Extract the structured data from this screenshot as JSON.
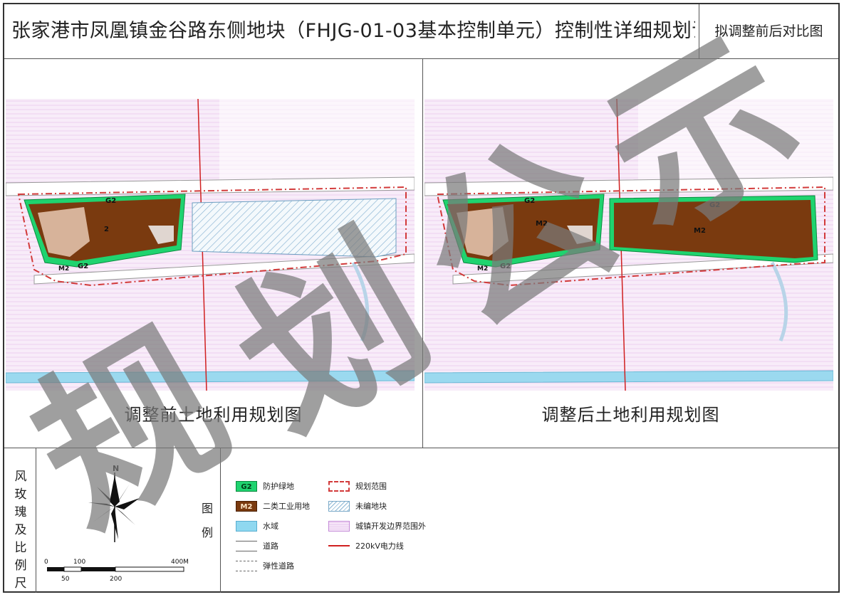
{
  "header": {
    "title": "张家港市凤凰镇金谷路东侧地块（FHJG-01-03基本控制单元）控制性详细规划调整",
    "subtitle": "拟调整前后对比图"
  },
  "panels": {
    "before": {
      "caption": "调整前土地利用规划图",
      "labels": {
        "g2_top": "G2",
        "g2_bottom": "G2",
        "m2_small": "M2",
        "m2_main": "2"
      }
    },
    "after": {
      "caption": "调整后土地利用规划图",
      "labels": {
        "g2_top": "G2",
        "g2_right": "G2",
        "g2_bottom": "G2",
        "m2_left": "M2",
        "m2_right": "M2",
        "m2_small": "M2"
      }
    }
  },
  "scale": {
    "title_chars": [
      "风",
      "玫",
      "瑰",
      "及",
      "比",
      "例",
      "尺"
    ],
    "north": "N",
    "ticks_top": [
      "0",
      "100",
      "400M"
    ],
    "ticks_bottom": [
      "50",
      "200"
    ]
  },
  "legend": {
    "title_chars": [
      "图",
      "例"
    ],
    "items": [
      {
        "code": "G2",
        "label": "防护绿地",
        "swatch": "g2"
      },
      {
        "code": "M2",
        "label": "二类工业用地",
        "swatch": "m2"
      },
      {
        "code": "",
        "label": "水域",
        "swatch": "water"
      },
      {
        "code": "",
        "label": "道路",
        "swatch": "road"
      },
      {
        "code": "",
        "label": "弹性道路",
        "swatch": "flex"
      },
      {
        "code": "",
        "label": "规划范围",
        "swatch": "boundary"
      },
      {
        "code": "",
        "label": "未编地块",
        "swatch": "unplanned"
      },
      {
        "code": "",
        "label": "城镇开发边界范围外",
        "swatch": "outside"
      },
      {
        "code": "",
        "label": "220kV电力线",
        "swatch": "power"
      }
    ]
  },
  "watermark": {
    "chars": [
      "规",
      "划",
      "公",
      "示"
    ]
  },
  "colors": {
    "industrial": "#7a3a0f",
    "green_buffer": "#1fd36f",
    "boundary": "#d23a3a",
    "power_line": "#d02020",
    "outside_zone": "#f3def5",
    "water": "#8fd8f0",
    "watermark": "#7a7a7a"
  }
}
